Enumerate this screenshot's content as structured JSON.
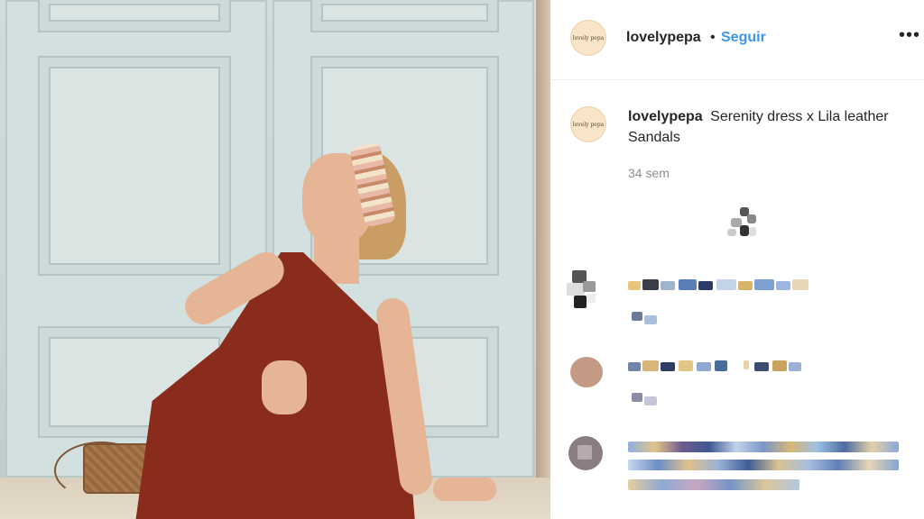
{
  "post": {
    "username": "lovelypepa",
    "separator": "•",
    "follow_label": "Seguir",
    "more_label": "•••",
    "avatar_text": "lovely pepa",
    "caption_text": "Serenity dress x Lila leather Sandals",
    "time_ago": "34 sem"
  },
  "colors": {
    "accent": "#3897f0",
    "text": "#262626",
    "muted": "#8e8e8e"
  }
}
